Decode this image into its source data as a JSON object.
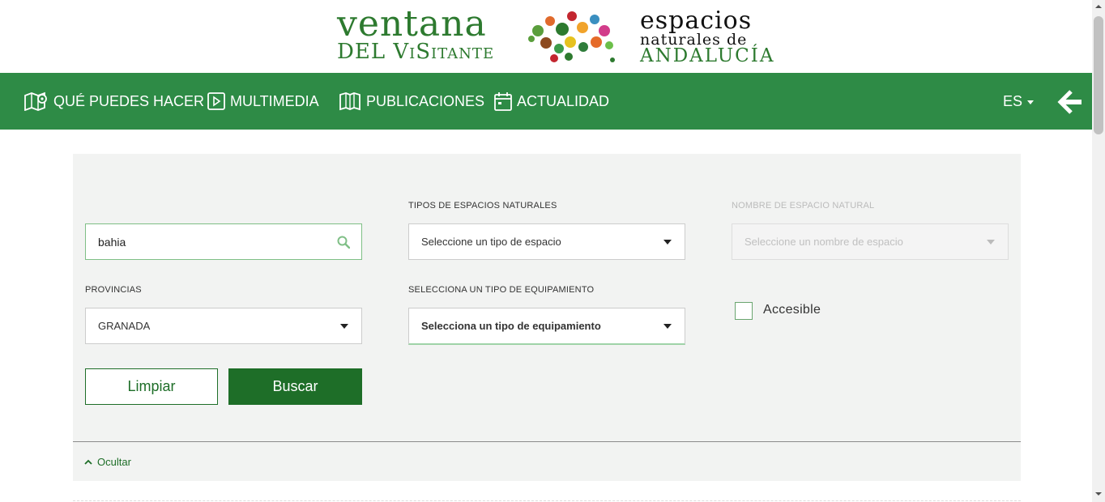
{
  "logo": {
    "left_line1": "ventana",
    "left_line2": "DEL ViSitante",
    "right_line1": "espacios",
    "right_line2": "naturales de",
    "right_line3": "ANDALUCÍA",
    "accent_color": "#2d7a2f"
  },
  "nav": {
    "background": "#2e8b46",
    "items": [
      {
        "label": "QUÉ PUEDES HACER",
        "icon": "map-pin-icon"
      },
      {
        "label": "MULTIMEDIA",
        "icon": "play-icon"
      },
      {
        "label": "PUBLICACIONES",
        "icon": "book-icon"
      },
      {
        "label": "ACTUALIDAD",
        "icon": "calendar-icon"
      }
    ],
    "language": "ES",
    "back_icon": "arrow-left-icon"
  },
  "filters": {
    "search": {
      "value": "bahia",
      "icon": "search-icon"
    },
    "space_type": {
      "label": "TIPOS DE ESPACIOS NATURALES",
      "value": "Seleccione un tipo de espacio"
    },
    "space_name": {
      "label": "NOMBRE DE ESPACIO NATURAL",
      "value": "Seleccione un nombre de espacio"
    },
    "province": {
      "label": "PROVINCIAS",
      "value": "GRANADA"
    },
    "equipment": {
      "label": "SELECCIONA UN TIPO DE EQUIPAMIENTO",
      "value": "Selecciona un tipo de equipamiento"
    },
    "accessible": {
      "label": "Accesible",
      "checked": false
    }
  },
  "buttons": {
    "clear": "Limpiar",
    "search": "Buscar"
  },
  "toggle": {
    "label": "Ocultar"
  }
}
